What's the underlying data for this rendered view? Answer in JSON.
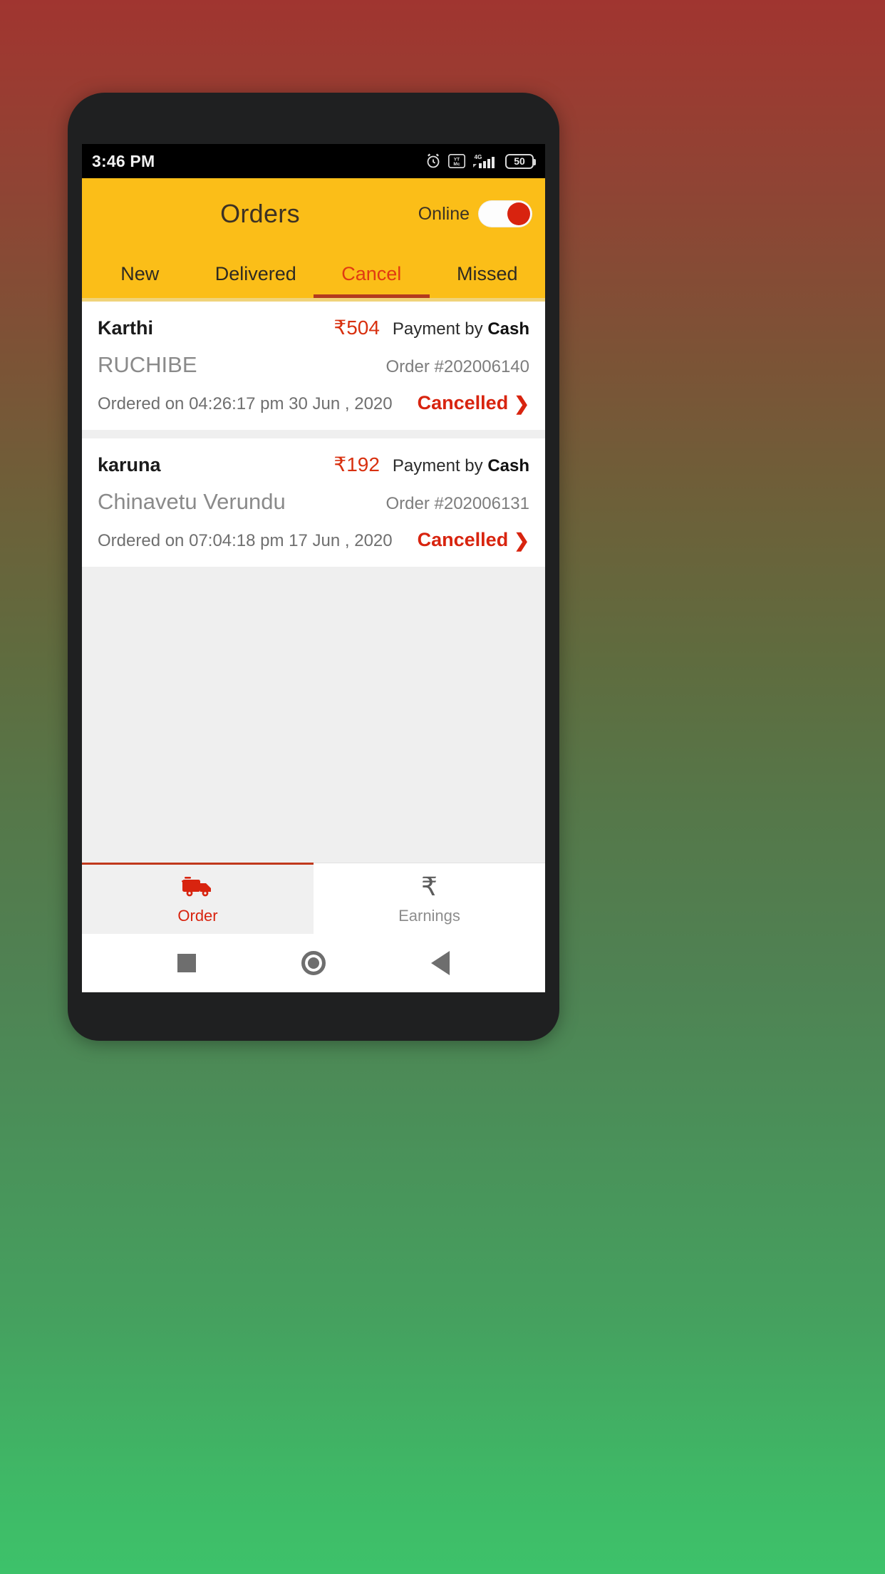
{
  "status_bar": {
    "time": "3:46 PM",
    "battery_percent": "50",
    "icons": [
      "alarm-icon",
      "youtube-music-icon",
      "signal-4g-icon",
      "battery-icon"
    ]
  },
  "app_bar": {
    "title": "Orders",
    "online_label": "Online",
    "online_state": "on"
  },
  "tabs": [
    {
      "label": "New",
      "active": false
    },
    {
      "label": "Delivered",
      "active": false
    },
    {
      "label": "Cancel",
      "active": true
    },
    {
      "label": "Missed",
      "active": false
    }
  ],
  "orders": [
    {
      "customer": "Karthi",
      "amount": "₹504",
      "payment_prefix": "Payment by",
      "payment_method": "Cash",
      "shop": "RUCHIBE",
      "order_id": "Order #202006140",
      "ordered_on": "Ordered on 04:26:17 pm 30 Jun , 2020",
      "status": "Cancelled"
    },
    {
      "customer": "karuna",
      "amount": "₹192",
      "payment_prefix": "Payment by",
      "payment_method": "Cash",
      "shop": "Chinavetu Verundu",
      "order_id": "Order #202006131",
      "ordered_on": "Ordered on 07:04:18 pm 17 Jun , 2020",
      "status": "Cancelled"
    }
  ],
  "bottom_nav": [
    {
      "label": "Order",
      "icon": "truck-icon",
      "active": true
    },
    {
      "label": "Earnings",
      "icon": "rupee-icon",
      "active": false
    }
  ],
  "soft_keys": [
    {
      "name": "recents-key"
    },
    {
      "name": "home-key"
    },
    {
      "name": "back-key"
    }
  ],
  "colors": {
    "brand_yellow": "#fbbe18",
    "accent_red": "#d8240f",
    "text_dark": "#1b1b1b",
    "text_muted": "#8a8a8a"
  }
}
